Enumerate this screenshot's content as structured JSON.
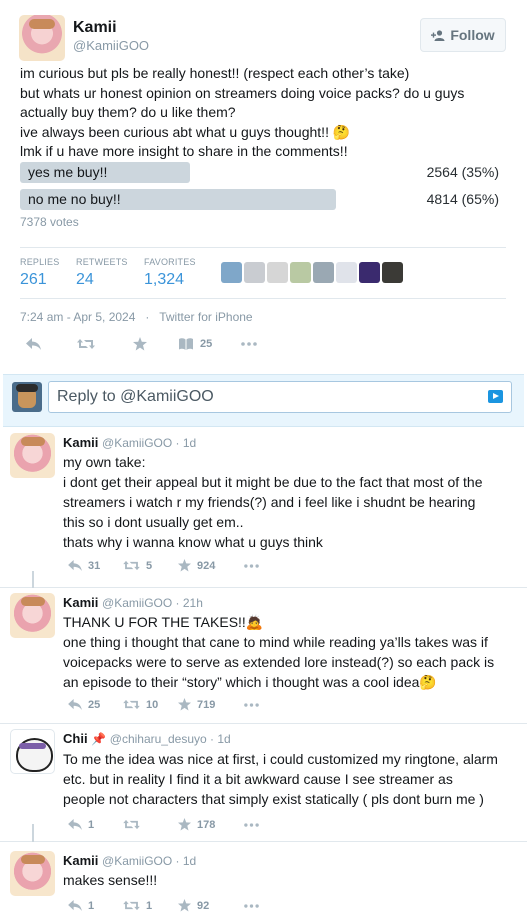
{
  "tweet": {
    "display_name": "Kamii",
    "screen_name": "@KamiiGOO",
    "follow_label": "Follow",
    "text_lines": [
      "im curious but pls be really honest!! (respect each other’s take)",
      "but whats ur honest opinion on streamers doing voice packs? do u guys",
      "actually buy them? do u like them?",
      "ive always been curious abt what u guys thought!! 🤔",
      "lmk if u have more insight to share in the comments!!"
    ],
    "poll": {
      "options": [
        {
          "label": "yes me buy!!",
          "count": "2564 (35%)",
          "percent": 35
        },
        {
          "label": "no me no buy!!",
          "count": "4814 (65%)",
          "percent": 65
        }
      ],
      "votes": "7378 votes"
    },
    "stats": {
      "replies_label": "REPLIES",
      "replies": "261",
      "retweets_label": "RETWEETS",
      "retweets": "24",
      "favorites_label": "FAVORITES",
      "favorites": "1,324"
    },
    "liker_colors": [
      "#7fa7c9",
      "#c9ccd1",
      "#d6d6d6",
      "#b9c9a3",
      "#9aa8b3",
      "#e0e3ea",
      "#3a2a6e",
      "#3b3a36"
    ],
    "timestamp": "7:24 am - Apr 5, 2024",
    "source": "Twitter for iPhone",
    "bookmark_count": "25"
  },
  "reply_box": {
    "placeholder": "Reply to @KamiiGOO"
  },
  "replies": [
    {
      "name": "Kamii",
      "meta": "@KamiiGOO · 1d",
      "lines": [
        "my own take:",
        "i dont get their appeal but it might be due to the fact that most of the",
        "streamers i watch r my friends(?) and i feel like i shudnt be hearing",
        "this so i dont usually get em..",
        "thats why i wanna know what u guys think"
      ],
      "reply_count": "31",
      "retweet_count": "5",
      "like_count": "924"
    },
    {
      "name": "Kamii",
      "meta": "@KamiiGOO · 21h",
      "lines": [
        "THANK U FOR THE TAKES!!🙇",
        "one thing i thought that cane to mind while reading ya’lls takes was if",
        "voicepacks were to serve as extended lore instead(?) so each pack is",
        "an episode to their “story” which i thought was a cool idea🤔"
      ],
      "reply_count": "25",
      "retweet_count": "10",
      "like_count": "719"
    },
    {
      "name": "Chii",
      "pin": "📌",
      "meta": "@chiharu_desuyo · 1d",
      "lines": [
        "To me the idea was nice at first, i could customized my ringtone, alarm",
        "etc. but in reality I find it a bit awkward cause I see streamer as",
        "people not characters that simply exist statically ( pls dont burn me )"
      ],
      "reply_count": "1",
      "retweet_count": "",
      "like_count": "178"
    },
    {
      "name": "Kamii",
      "meta": "@KamiiGOO · 1d",
      "lines": [
        "makes sense!!!"
      ],
      "reply_count": "1",
      "retweet_count": "1",
      "like_count": "92"
    }
  ]
}
